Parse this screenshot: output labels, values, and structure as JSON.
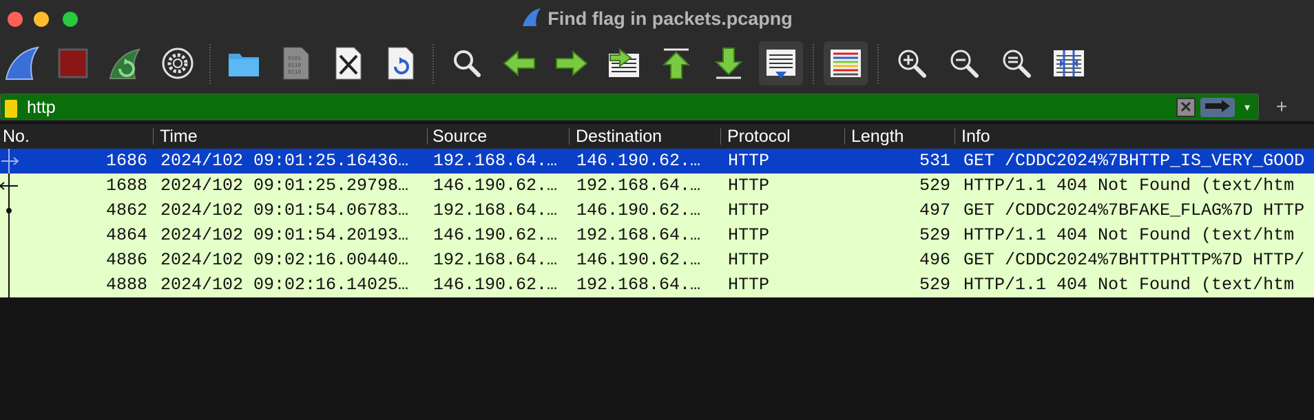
{
  "window": {
    "title": "Find flag in packets.pcapng",
    "app_icon": "wireshark-fin-icon"
  },
  "toolbar": {
    "buttons": [
      {
        "name": "start-capture-button",
        "icon": "shark-fin-icon"
      },
      {
        "name": "stop-capture-button",
        "icon": "stop-square-icon"
      },
      {
        "name": "restart-capture-button",
        "icon": "restart-fin-icon"
      },
      {
        "name": "capture-options-button",
        "icon": "gear-icon"
      },
      {
        "name": "open-file-button",
        "icon": "folder-icon"
      },
      {
        "name": "save-file-button",
        "icon": "binary-file-icon"
      },
      {
        "name": "close-file-button",
        "icon": "close-file-icon"
      },
      {
        "name": "reload-file-button",
        "icon": "reload-file-icon"
      },
      {
        "name": "find-packet-button",
        "icon": "magnifier-icon"
      },
      {
        "name": "go-back-button",
        "icon": "arrow-left-icon"
      },
      {
        "name": "go-forward-button",
        "icon": "arrow-right-icon"
      },
      {
        "name": "go-to-packet-button",
        "icon": "go-to-packet-icon"
      },
      {
        "name": "first-packet-button",
        "icon": "arrow-top-icon"
      },
      {
        "name": "last-packet-button",
        "icon": "arrow-bottom-icon"
      },
      {
        "name": "auto-scroll-button",
        "icon": "auto-scroll-icon"
      },
      {
        "name": "colorize-button",
        "icon": "colorize-lines-icon"
      },
      {
        "name": "zoom-in-button",
        "icon": "zoom-in-icon"
      },
      {
        "name": "zoom-out-button",
        "icon": "zoom-out-icon"
      },
      {
        "name": "zoom-normal-button",
        "icon": "zoom-reset-icon"
      },
      {
        "name": "resize-columns-button",
        "icon": "resize-columns-icon"
      }
    ]
  },
  "filter": {
    "value": "http",
    "clear_glyph": "✕",
    "add_glyph": "+",
    "dropdown_glyph": "▾"
  },
  "columns": [
    "No.",
    "Time",
    "Source",
    "Destination",
    "Protocol",
    "Length",
    "Info"
  ],
  "packets": [
    {
      "no": "1686",
      "time": "2024/102 09:01:25.16436…",
      "source": "192.168.64.…",
      "destination": "146.190.62.…",
      "protocol": "HTTP",
      "length": "531",
      "info": "GET /CDDC2024%7BHTTP_IS_VERY_GOOD",
      "selected": true
    },
    {
      "no": "1688",
      "time": "2024/102 09:01:25.29798…",
      "source": "146.190.62.…",
      "destination": "192.168.64.…",
      "protocol": "HTTP",
      "length": "529",
      "info": "HTTP/1.1 404 Not Found  (text/htm",
      "selected": false
    },
    {
      "no": "4862",
      "time": "2024/102 09:01:54.06783…",
      "source": "192.168.64.…",
      "destination": "146.190.62.…",
      "protocol": "HTTP",
      "length": "497",
      "info": "GET /CDDC2024%7BFAKE_FLAG%7D HTTP",
      "selected": false
    },
    {
      "no": "4864",
      "time": "2024/102 09:01:54.20193…",
      "source": "146.190.62.…",
      "destination": "192.168.64.…",
      "protocol": "HTTP",
      "length": "529",
      "info": "HTTP/1.1 404 Not Found  (text/htm",
      "selected": false
    },
    {
      "no": "4886",
      "time": "2024/102 09:02:16.00440…",
      "source": "192.168.64.…",
      "destination": "146.190.62.…",
      "protocol": "HTTP",
      "length": "496",
      "info": "GET /CDDC2024%7BHTTPHTTP%7D HTTP/",
      "selected": false
    },
    {
      "no": "4888",
      "time": "2024/102 09:02:16.14025…",
      "source": "146.190.62.…",
      "destination": "192.168.64.…",
      "protocol": "HTTP",
      "length": "529",
      "info": "HTTP/1.1 404 Not Found  (text/htm",
      "selected": false
    }
  ],
  "colors": {
    "filter_valid": "#0a6e0a",
    "row_http": "#e4ffc7",
    "row_selected": "#0a3fc8"
  }
}
